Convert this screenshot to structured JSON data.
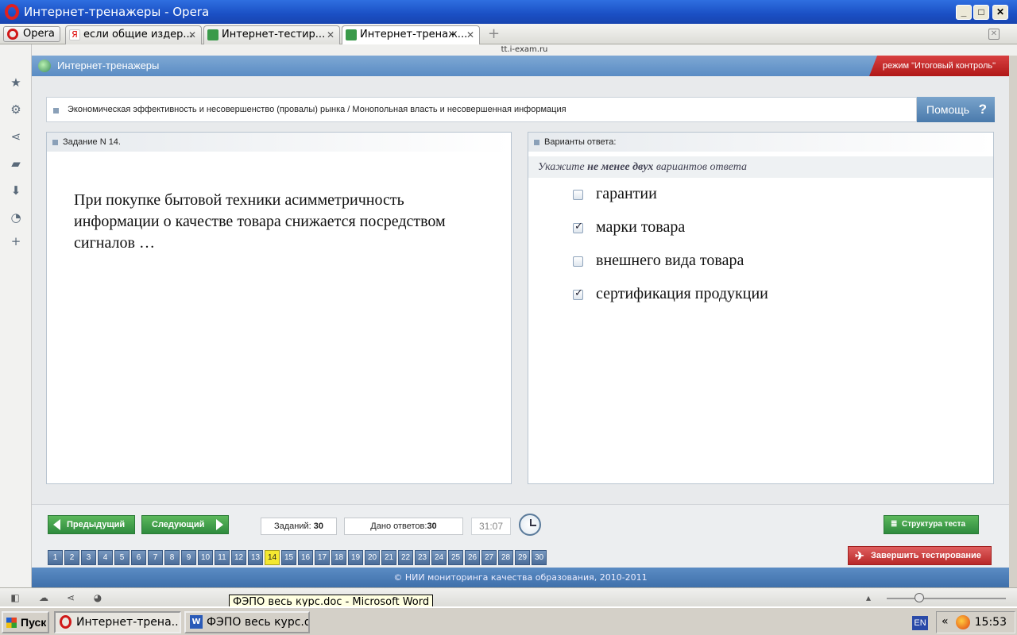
{
  "window": {
    "title": "Интернет-тренажеры - Opera"
  },
  "browser": {
    "menu_label": "Opera",
    "tabs": [
      {
        "label": "если общие издер..."
      },
      {
        "label": "Интернет-тестир..."
      },
      {
        "label": "Интернет-тренаж..."
      }
    ],
    "url": "tt.i-exam.ru",
    "tooltip": "ФЭПО весь курс.doc - Microsoft Word"
  },
  "app": {
    "title": "Интернет-тренажеры",
    "mode": "режим \"Итоговый контроль\"",
    "breadcrumb": "Экономическая эффективность и несовершенство (провалы) рынка / Монопольная власть и несовершенная информация",
    "help_label": "Помощь",
    "help_symbol": "?",
    "task_heading": "Задание N 14.",
    "question": "При покупке бытовой техники асимметричность информации о качестве товара снижается посредством сигналов …",
    "answers_heading": "Варианты ответа:",
    "instruction": {
      "pre": "Укажите",
      "bold": "не менее двух",
      "post": "вариантов ответа"
    },
    "options": [
      {
        "label": "гарантии",
        "checked": false
      },
      {
        "label": "марки товара",
        "checked": true
      },
      {
        "label": "внешнего вида товара",
        "checked": false
      },
      {
        "label": "сертификация продукции",
        "checked": true
      }
    ],
    "controls": {
      "prev_label": "Предыдущий",
      "next_label": "Следующий",
      "tasks_label": "Заданий:",
      "tasks_value": "30",
      "answered_label": "Дано ответов:",
      "answered_value": "30",
      "timer": "31:07",
      "structure_label": "Структура теста",
      "finish_label": "Завершить тестирование"
    },
    "pages": [
      "1",
      "2",
      "3",
      "4",
      "5",
      "6",
      "7",
      "8",
      "9",
      "10",
      "11",
      "12",
      "13",
      "14",
      "15",
      "16",
      "17",
      "18",
      "19",
      "20",
      "21",
      "22",
      "23",
      "24",
      "25",
      "26",
      "27",
      "28",
      "29",
      "30"
    ],
    "current_page": "14",
    "footer": "© НИИ мониторинга качества образования, 2010-2011"
  },
  "taskbar": {
    "start_label": "Пуск",
    "tasks": [
      {
        "label": "Интернет-трена..."
      },
      {
        "label": "ФЭПО весь курс.d..."
      }
    ],
    "lang": "EN",
    "tray_arrows": "«",
    "clock": "15:53"
  }
}
